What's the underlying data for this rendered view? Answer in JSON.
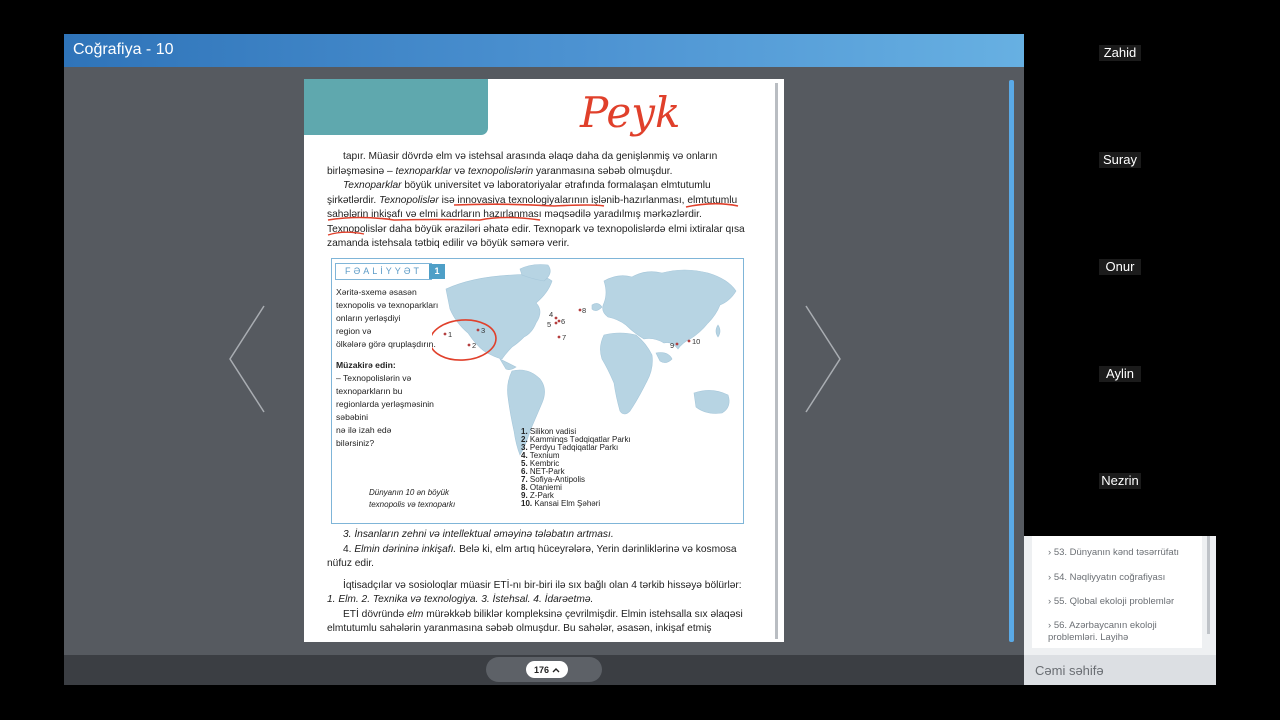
{
  "window": {
    "title": "Coğrafiya - 10"
  },
  "page": {
    "handwriting": "Peyk",
    "paragraphs": {
      "p1a": "tapır. Müasir dövrdə elm və istehsal arasında əlaqə daha da genişlənmiş və onların",
      "p1b_pre": "birləşməsinə – ",
      "p1b_it1": "texnoparklar",
      "p1b_mid": " və ",
      "p1b_it2": "texnopolislərin",
      "p1b_post": " yaranmasına səbəb olmuşdur.",
      "p2a_it": "Texnoparklar",
      "p2a": " böyük universitet və laboratoriyalar ətrafında formalaşan elmtutumlu",
      "p2b_pre": "şirkətlərdir. ",
      "p2b_it": "Texnopolislər",
      "p2b": " isə innovasiya texnologiyalarının işlənib-hazırlanması, elmtutumlu",
      "p2c": "sahələrin inkişafı və elmi kadrların hazırlanması məqsədilə yaradılmış mərkəzlərdir.",
      "p3a": "Texnopolislər daha böyük əraziləri əhatə edir. Texnopark və texnopolislərdə elmi ixtiralar qısa",
      "p3b": "zamanda istehsala tətbiq edilir və böyük səmərə verir.",
      "p4": "3. İnsanların zehni və intellektual əməyinə tələbatın artması.",
      "p5_pre": "4. ",
      "p5_it": "Elmin dərininə inkişafı.",
      "p5": " Belə ki, elm artıq hüceyrələrə, Yerin dərinliklərinə və kosmosa",
      "p5b": "nüfuz edir.",
      "p6": "İqtisadçılar və sosioloqlar müasir ETİ-nı bir-biri ilə sıx bağlı olan 4 tərkib hissəyə bölürlər:",
      "p7": "1. Elm. 2. Texnika və texnologiya. 3. İstehsal. 4. İdarəetmə.",
      "p8_pre": "ETİ dövründə ",
      "p8_it": "elm",
      "p8": " mürəkkəb biliklər kompleksinə çevrilmişdir. Elmin istehsalla sıx əlaqəsi",
      "p9": "elmtutumlu sahələrin yaranmasına səbəb olmuşdur. Bu sahələr, əsasən, inkişaf etmiş"
    },
    "activity": {
      "label": "FƏALİYYƏT",
      "number": "1",
      "task_lines": [
        "Xəritə-sxemə əsasən",
        "texnopolis və texnoparkları",
        "onların yerləşdiyi",
        "region və",
        "ölkələrə görə qruplaşdırın."
      ],
      "discuss_title": "Müzakirə edin:",
      "discuss_lines": [
        "– Texnopolislərin və",
        "texnoparkların bu",
        "regionlarda yerləşməsinin",
        "səbəbini",
        "nə ilə izah edə",
        "bilərsiniz?"
      ],
      "caption_lines": [
        "Dünyanın 10 ən böyük",
        "texnopolis və texnoparkı"
      ],
      "map_points": [
        "1",
        "2",
        "3",
        "4",
        "5",
        "6",
        "7",
        "8",
        "9",
        "10"
      ],
      "legend": [
        {
          "n": "1.",
          "name": "Silikon vadisi"
        },
        {
          "n": "2.",
          "name": "Kamminqs Tədqiqatlar Parkı"
        },
        {
          "n": "3.",
          "name": "Perdyu Tədqiqatlar Parkı"
        },
        {
          "n": "4.",
          "name": "Texnium"
        },
        {
          "n": "5.",
          "name": "Kembric"
        },
        {
          "n": "6.",
          "name": "NET-Park"
        },
        {
          "n": "7.",
          "name": "Sofiya-Antipolis"
        },
        {
          "n": "8.",
          "name": "Otaniemi"
        },
        {
          "n": "9.",
          "name": "Z-Park"
        },
        {
          "n": "10.",
          "name": "Kansai Elm Şəhəri"
        }
      ]
    }
  },
  "footer": {
    "page_number": "176"
  },
  "participants": [
    "Zahid",
    "Suray",
    "Onur",
    "Aylin",
    "Nezrin"
  ],
  "toc": {
    "items": [
      "53. Dünyanın kənd təsərrüfatı",
      "54. Nəqliyyatın coğrafiyası",
      "55. Qlobal ekoloji problemlər"
    ],
    "item4_lines": [
      "56. Azərbaycanın ekoloji",
      "problemləri. Layihə"
    ],
    "all_pages": "Cəmi səhifə"
  },
  "colors": {
    "titlebar": "#2f74b9",
    "header_tab": "#5fa8ae",
    "annotation": "#e0402b",
    "activity_border": "#7fb5d8"
  }
}
